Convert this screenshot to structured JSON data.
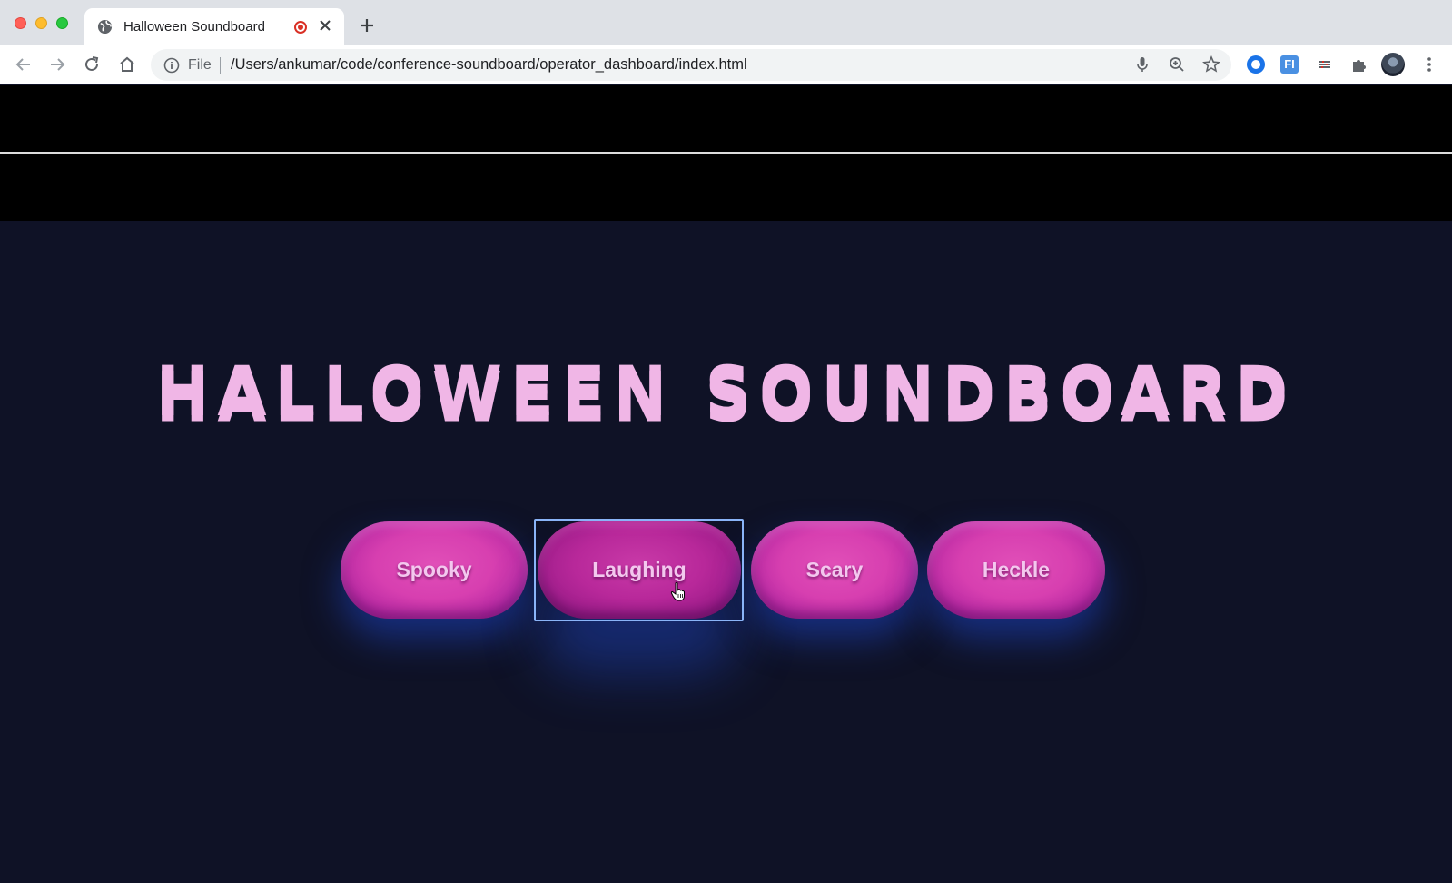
{
  "browser": {
    "tab_title": "Halloween Soundboard",
    "address_scheme": "File",
    "address_url": "/Users/ankumar/code/conference-soundboard/operator_dashboard/index.html",
    "extension_fi_label": "FI"
  },
  "page": {
    "title": "HALLOWEEN SOUNDBOARD",
    "buttons": [
      "Spooky",
      "Laughing",
      "Scary",
      "Heckle"
    ],
    "focused_button": "Laughing"
  },
  "colors": {
    "title": "#f0b6e6",
    "button_pink": "#d73fb0",
    "page_background": "#0f1226",
    "glow_blue": "#1e46c8"
  }
}
